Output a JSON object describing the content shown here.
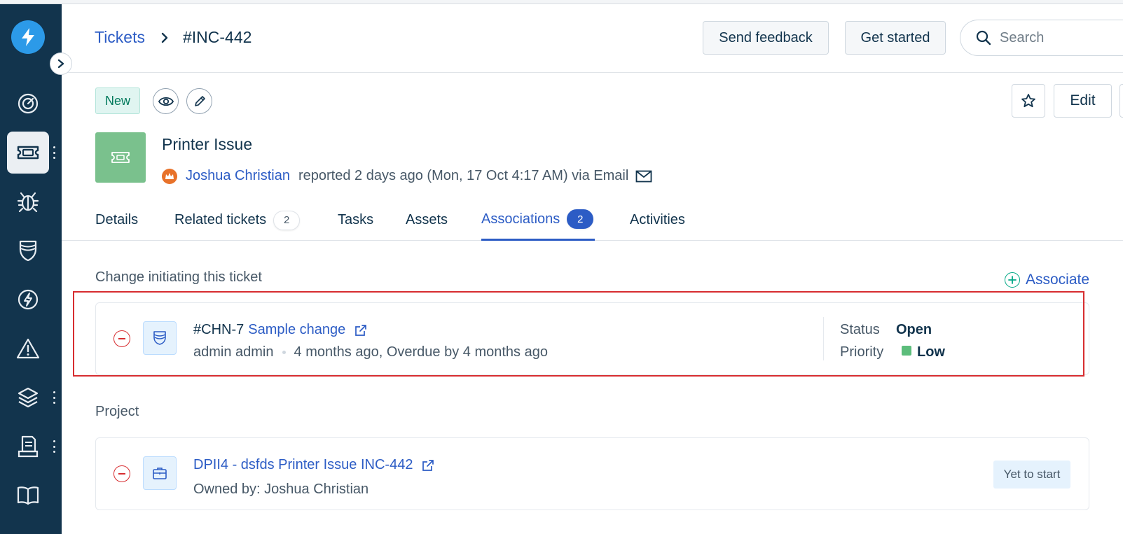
{
  "header": {
    "breadcrumb_root": "Tickets",
    "breadcrumb_current": "#INC-442",
    "send_feedback": "Send feedback",
    "get_started": "Get started",
    "search_placeholder": "Search"
  },
  "sidebar": {
    "items": [
      {
        "icon": "dashboard-icon"
      },
      {
        "icon": "tickets-icon",
        "active": true
      },
      {
        "icon": "problems-bug-icon"
      },
      {
        "icon": "changes-shield-icon"
      },
      {
        "icon": "releases-bolt-icon"
      },
      {
        "icon": "alerts-warning-icon"
      },
      {
        "icon": "assets-layers-icon"
      },
      {
        "icon": "contracts-document-icon"
      },
      {
        "icon": "solutions-book-icon"
      }
    ]
  },
  "ticket": {
    "status_badge": "New",
    "title": "Printer Issue",
    "reporter": "Joshua Christian",
    "reported_text": "reported 2 days ago (Mon, 17 Oct 4:17 AM) via Email",
    "edit_label": "Edit"
  },
  "tabs": [
    {
      "label": "Details"
    },
    {
      "label": "Related tickets",
      "count": "2"
    },
    {
      "label": "Tasks"
    },
    {
      "label": "Assets"
    },
    {
      "label": "Associations",
      "count": "2",
      "active": true
    },
    {
      "label": "Activities"
    }
  ],
  "associations": {
    "change_section_title": "Change initiating this ticket",
    "associate_label": "Associate",
    "change": {
      "id": "#CHN-7",
      "name": "Sample change",
      "requester": "admin admin",
      "timing": "4 months ago, Overdue by 4 months ago",
      "status_label": "Status",
      "status_value": "Open",
      "priority_label": "Priority",
      "priority_value": "Low",
      "priority_color": "#5cbd7b"
    },
    "project_section_title": "Project",
    "project": {
      "name": "DPII4 - dsfds Printer Issue INC-442",
      "owner": "Owned by: Joshua Christian",
      "status": "Yet to start"
    }
  },
  "colors": {
    "sidebar_bg": "#12344d",
    "link": "#2c5cc5",
    "highlight_box": "#d72d30",
    "ticket_icon_bg": "#7ac18d"
  }
}
